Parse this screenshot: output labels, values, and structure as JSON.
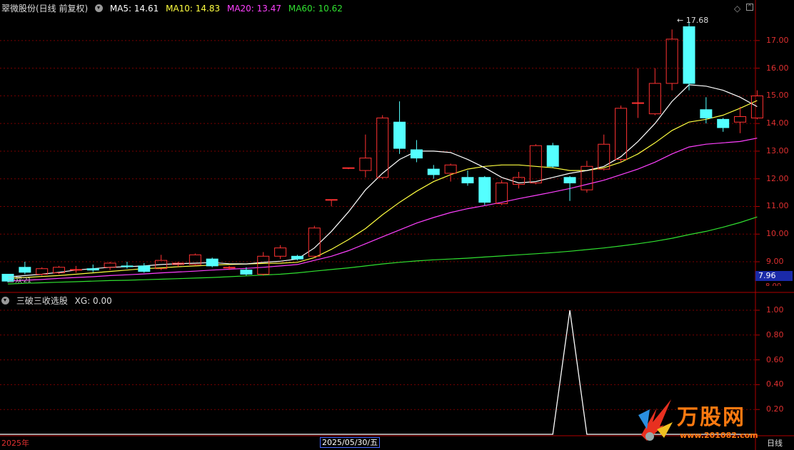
{
  "header": {
    "title": "翠微股份(日线 前复权)",
    "ma5": "MA5: 14.61",
    "ma10": "MA10: 14.83",
    "ma20": "MA20: 13.47",
    "ma60": "MA60: 10.62"
  },
  "indicator": {
    "title": "三破三收选股",
    "xg": "XG: 0.00"
  },
  "price_axis": [
    "17.00",
    "16.00",
    "15.00",
    "14.00",
    "13.00",
    "12.00",
    "11.00",
    "10.00",
    "9.00"
  ],
  "current_price": "7.96",
  "high_label": "17.68",
  "indicator_axis": [
    "1.00",
    "0.80",
    "0.60",
    "0.40",
    "0.20"
  ],
  "dates": {
    "start": "2025年",
    "selected": "2025/05/30/五",
    "period": "日线"
  },
  "watermark": {
    "brand": "万股网",
    "url": "www.201082.com"
  },
  "colors": {
    "up": "#ff3232",
    "down": "#54ffff",
    "ma5": "#ffffff",
    "ma10": "#ffff40",
    "ma20": "#ff40ff",
    "ma60": "#30e030",
    "grid": "#7a0000"
  },
  "chart_data": {
    "type": "candlestick",
    "candles": [
      [
        8.55,
        8.3,
        8.55,
        8.25
      ],
      [
        8.8,
        8.62,
        9.0,
        8.55
      ],
      [
        8.55,
        8.75,
        8.8,
        8.5
      ],
      [
        8.6,
        8.8,
        8.85,
        8.55
      ],
      [
        8.7,
        8.72,
        8.85,
        8.6
      ],
      [
        8.75,
        8.7,
        8.9,
        8.62
      ],
      [
        8.8,
        8.95,
        9.0,
        8.7
      ],
      [
        8.85,
        8.82,
        9.0,
        8.75
      ],
      [
        8.85,
        8.65,
        8.95,
        8.6
      ],
      [
        8.75,
        9.05,
        9.25,
        8.7
      ],
      [
        8.9,
        8.95,
        9.0,
        8.82
      ],
      [
        8.9,
        9.25,
        9.3,
        8.85
      ],
      [
        9.1,
        8.85,
        9.15,
        8.8
      ],
      [
        8.8,
        8.8,
        8.85,
        8.7
      ],
      [
        8.7,
        8.55,
        8.8,
        8.5
      ],
      [
        8.55,
        9.2,
        9.35,
        8.5
      ],
      [
        9.2,
        9.5,
        9.6,
        9.1
      ],
      [
        9.2,
        9.1,
        9.25,
        9.05
      ],
      [
        9.2,
        10.22,
        10.3,
        9.15
      ],
      [
        11.25,
        11.25,
        11.25,
        11.0
      ],
      [
        12.4,
        12.4,
        12.4,
        12.35
      ],
      [
        12.3,
        12.75,
        13.6,
        12.05
      ],
      [
        12.05,
        14.2,
        14.3,
        12.0
      ],
      [
        14.05,
        13.1,
        14.8,
        12.9
      ],
      [
        13.05,
        12.75,
        13.4,
        12.6
      ],
      [
        12.35,
        12.15,
        12.5,
        12.0
      ],
      [
        12.2,
        12.5,
        12.55,
        11.9
      ],
      [
        12.05,
        11.85,
        12.3,
        11.75
      ],
      [
        12.05,
        11.15,
        12.1,
        11.05
      ],
      [
        11.1,
        11.85,
        11.95,
        11.05
      ],
      [
        11.8,
        12.05,
        12.25,
        11.65
      ],
      [
        11.85,
        13.2,
        13.25,
        11.8
      ],
      [
        13.2,
        12.45,
        13.3,
        12.4
      ],
      [
        12.05,
        11.85,
        12.1,
        11.2
      ],
      [
        11.6,
        12.45,
        12.65,
        11.5
      ],
      [
        12.35,
        13.25,
        13.6,
        12.3
      ],
      [
        12.7,
        14.55,
        14.65,
        12.6
      ],
      [
        14.75,
        14.75,
        16.0,
        14.2
      ],
      [
        14.35,
        15.45,
        16.0,
        14.3
      ],
      [
        15.45,
        17.05,
        17.4,
        15.2
      ],
      [
        17.5,
        15.45,
        17.68,
        15.2
      ],
      [
        14.5,
        14.2,
        14.95,
        14.0
      ],
      [
        14.15,
        13.85,
        14.2,
        13.7
      ],
      [
        14.05,
        14.25,
        14.6,
        13.65
      ],
      [
        14.2,
        15.0,
        15.2,
        14.15
      ]
    ],
    "ma5": [
      8.45,
      8.5,
      8.55,
      8.62,
      8.7,
      8.75,
      8.8,
      8.82,
      8.85,
      8.9,
      8.93,
      8.95,
      8.97,
      8.93,
      8.92,
      8.98,
      9.02,
      9.1,
      9.5,
      10.1,
      10.8,
      11.6,
      12.2,
      12.7,
      13.0,
      13.0,
      12.95,
      12.7,
      12.4,
      12.05,
      11.85,
      11.9,
      12.05,
      12.2,
      12.3,
      12.45,
      12.8,
      13.35,
      14.0,
      14.8,
      15.4,
      15.35,
      15.2,
      14.95,
      14.61
    ],
    "ma10": [
      8.4,
      8.43,
      8.47,
      8.5,
      8.55,
      8.6,
      8.65,
      8.7,
      8.75,
      8.78,
      8.82,
      8.85,
      8.88,
      8.9,
      8.92,
      8.94,
      8.95,
      8.98,
      9.15,
      9.45,
      9.8,
      10.2,
      10.7,
      11.15,
      11.55,
      11.9,
      12.15,
      12.35,
      12.45,
      12.5,
      12.5,
      12.45,
      12.4,
      12.3,
      12.3,
      12.4,
      12.6,
      12.9,
      13.3,
      13.75,
      14.05,
      14.15,
      14.3,
      14.55,
      14.83
    ],
    "ma20": [
      8.3,
      8.33,
      8.36,
      8.4,
      8.43,
      8.46,
      8.5,
      8.53,
      8.56,
      8.6,
      8.63,
      8.66,
      8.7,
      8.73,
      8.76,
      8.8,
      8.85,
      8.9,
      9.05,
      9.2,
      9.4,
      9.65,
      9.9,
      10.15,
      10.4,
      10.6,
      10.78,
      10.92,
      11.03,
      11.15,
      11.28,
      11.4,
      11.52,
      11.65,
      11.8,
      11.95,
      12.15,
      12.35,
      12.6,
      12.9,
      13.15,
      13.25,
      13.3,
      13.35,
      13.47
    ],
    "ma60": [
      8.2,
      8.22,
      8.24,
      8.26,
      8.28,
      8.3,
      8.32,
      8.33,
      8.35,
      8.37,
      8.39,
      8.41,
      8.43,
      8.46,
      8.49,
      8.52,
      8.55,
      8.6,
      8.66,
      8.72,
      8.78,
      8.85,
      8.92,
      8.98,
      9.03,
      9.07,
      9.1,
      9.13,
      9.17,
      9.21,
      9.25,
      9.29,
      9.33,
      9.38,
      9.44,
      9.5,
      9.57,
      9.65,
      9.74,
      9.85,
      9.98,
      10.1,
      10.25,
      10.42,
      10.62
    ],
    "xg": [
      0,
      0,
      0,
      0,
      0,
      0,
      0,
      0,
      0,
      0,
      0,
      0,
      0,
      0,
      0,
      0,
      0,
      0,
      0,
      0,
      0,
      0,
      0,
      0,
      0,
      0,
      0,
      0,
      0,
      0,
      0,
      0,
      0,
      1,
      0,
      0,
      0,
      0,
      0,
      0,
      0,
      0,
      0,
      0,
      0
    ],
    "ylim": [
      8.15,
      17.95
    ],
    "indicator_ylim": [
      0,
      1.0
    ]
  }
}
